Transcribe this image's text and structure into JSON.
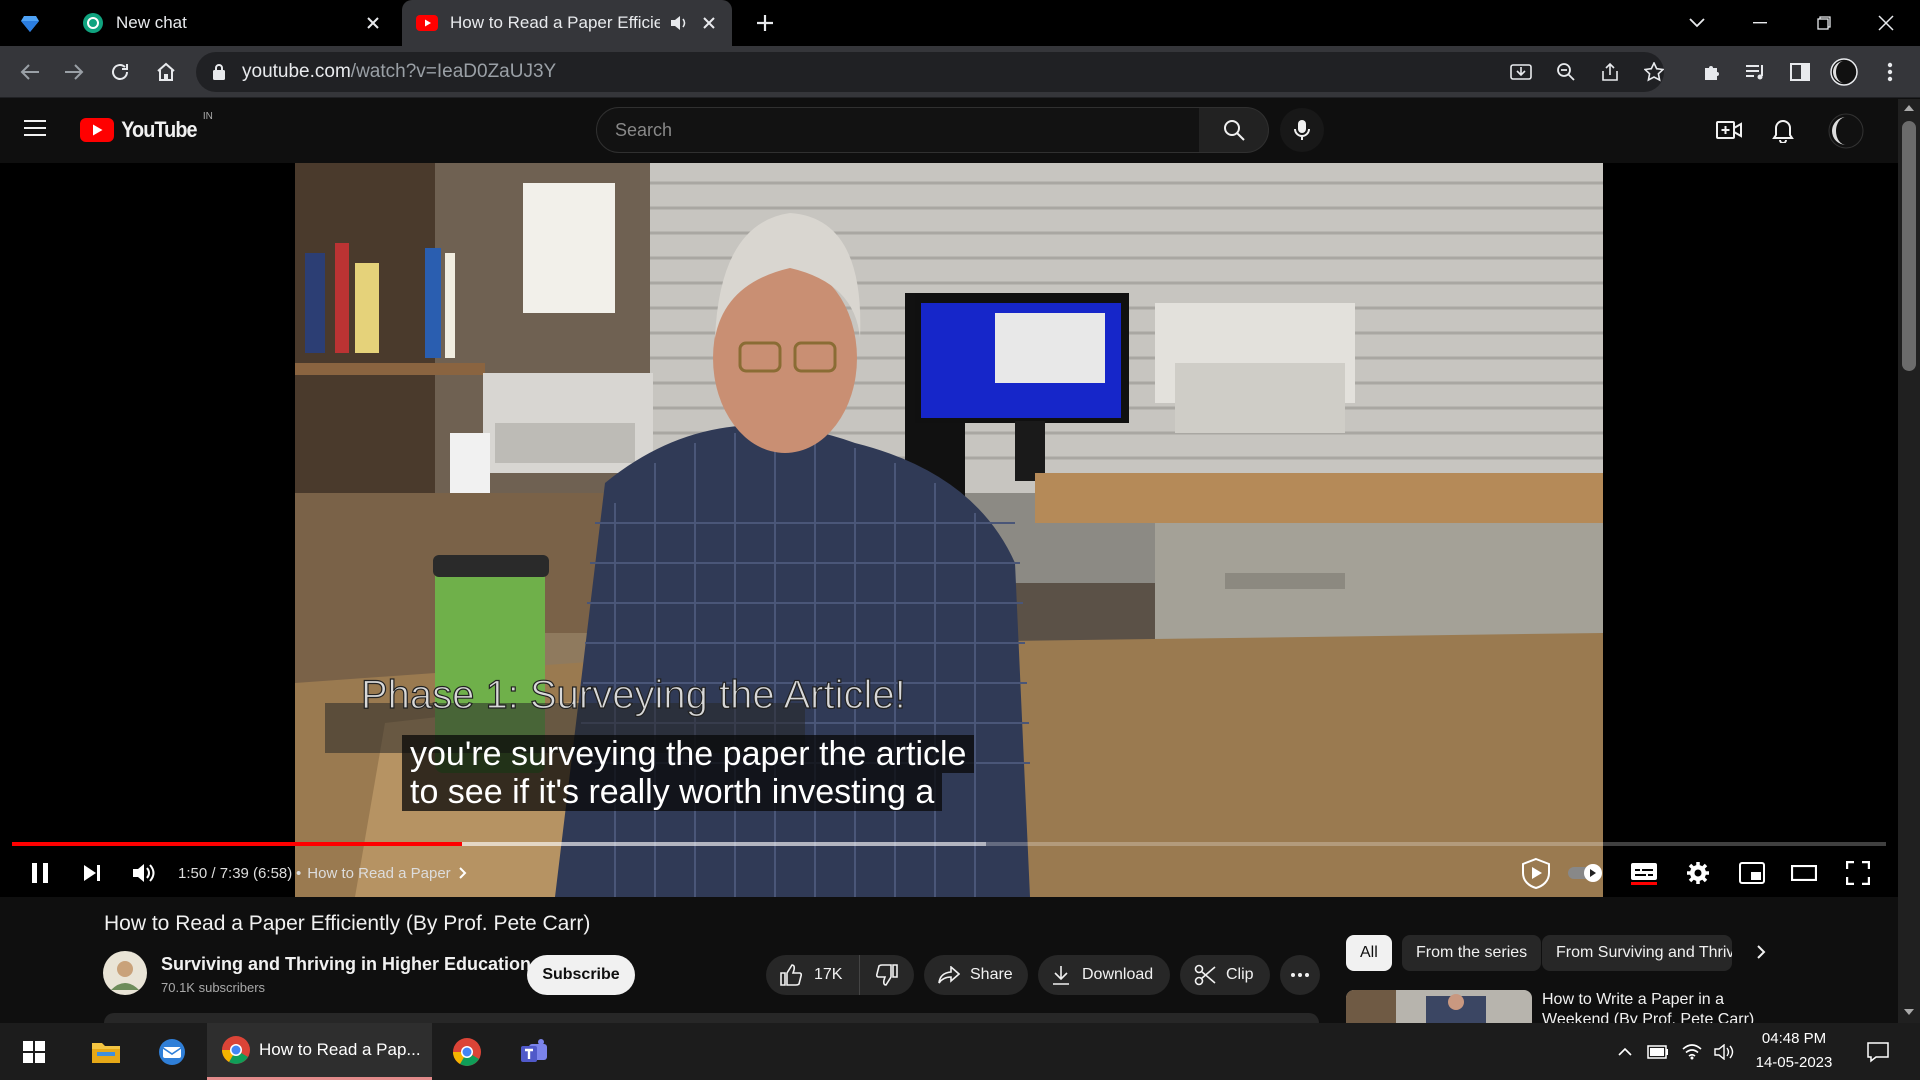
{
  "browser": {
    "tabs": [
      {
        "label": "",
        "icon": "gem-icon"
      },
      {
        "label": "New chat",
        "icon": "openai-icon"
      },
      {
        "label": "How to Read a Paper Efficien",
        "icon": "youtube-icon",
        "active": true
      }
    ],
    "url_host": "youtube.com",
    "url_path": "/watch?v=IeaD0ZaUJ3Y"
  },
  "youtube": {
    "logo_text": "YouTube",
    "region": "IN",
    "search_placeholder": "Search"
  },
  "player": {
    "captions": [
      "you're surveying the paper the article",
      "to see if it's really worth investing a"
    ],
    "overlay_text": "Phase 1: Surveying the Article!",
    "time": "1:50 / 7:39 (6:58)",
    "chapter": "How to Read a Paper",
    "progress_fraction": 0.24,
    "buffered_fraction": 0.52
  },
  "video": {
    "title": "How to Read a Paper Efficiently (By Prof. Pete Carr)",
    "channel": "Surviving and Thriving in Higher Education",
    "subscribers": "70.1K subscribers",
    "subscribe_label": "Subscribe",
    "likes": "17K",
    "share_label": "Share",
    "download_label": "Download",
    "clip_label": "Clip"
  },
  "recommendations": {
    "chips": [
      "All",
      "From the series",
      "From Surviving and Thriv"
    ],
    "first_title_line1": "How to Write a Paper in a",
    "first_title_line2": "Weekend (By Prof. Pete Carr)"
  },
  "taskbar": {
    "chrome_item": "How to Read a Pap...",
    "time": "04:48 PM",
    "date": "14-05-2023"
  },
  "colors": {
    "youtube_red": "#ff0000",
    "chrome_dark": "#35363a",
    "accent_blue": "#3ea6ff"
  }
}
